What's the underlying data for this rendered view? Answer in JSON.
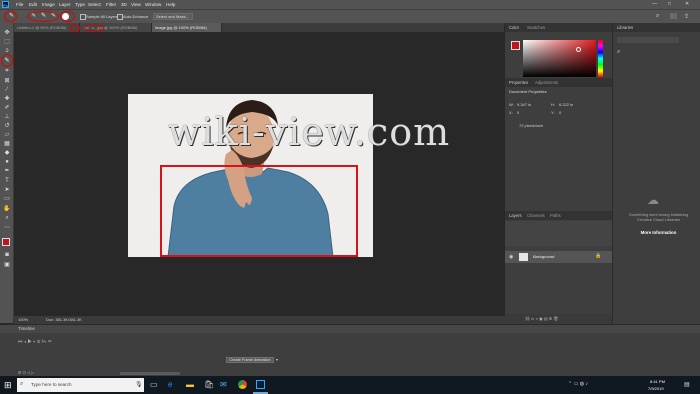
{
  "app": {
    "logo_text": "Ps"
  },
  "menu": [
    "File",
    "Edit",
    "Image",
    "Layer",
    "Type",
    "Select",
    "Filter",
    "3D",
    "View",
    "Window",
    "Help"
  ],
  "window_controls": [
    "—",
    "□",
    "✕"
  ],
  "options_bar": {
    "sample_all_layers": "Sample All Layers",
    "auto_enhance": "Auto-Enhance",
    "select_and_mask": "Select and Mask..."
  },
  "tabs": [
    {
      "label": "Untitled-1 @ 50% (RGB/8#)",
      "active": false
    },
    {
      "label": "1af...o...jpg @ 100% (RGB/8#)",
      "active": false
    },
    {
      "label": "image.jpg @ 100% (RGB/8#)",
      "active": true
    }
  ],
  "canvas": {
    "watermark": "wiki-view.com",
    "zoom": "100%",
    "doc_info": "Doc: 381.3K/381.3K"
  },
  "timeline": {
    "title": "Timeline",
    "create_button": "Create Frame Animation"
  },
  "color_panel": {
    "tabs": [
      "Color",
      "Swatches"
    ],
    "fg_color": "#c0151b"
  },
  "properties_panel": {
    "tabs": [
      "Properties",
      "Adjustments"
    ],
    "section": "Document Properties",
    "w_label": "W:",
    "w_value": "9.347 in",
    "h_label": "H:",
    "h_value": "6.222 in",
    "x_label": "X:",
    "x_value": "0",
    "y_label": "Y:",
    "y_value": "0",
    "resolution": "72 pixels/inch"
  },
  "layers_panel": {
    "tabs": [
      "Layers",
      "Channels",
      "Paths"
    ],
    "layer_name": "Background"
  },
  "libraries_panel": {
    "title": "Libraries",
    "error_text": "Something went wrong initializing Creative Cloud Libraries",
    "more_info": "More Information"
  },
  "taskbar": {
    "search_placeholder": "Type here to search",
    "time": "8:41 PM",
    "date": "7/9/2019"
  }
}
